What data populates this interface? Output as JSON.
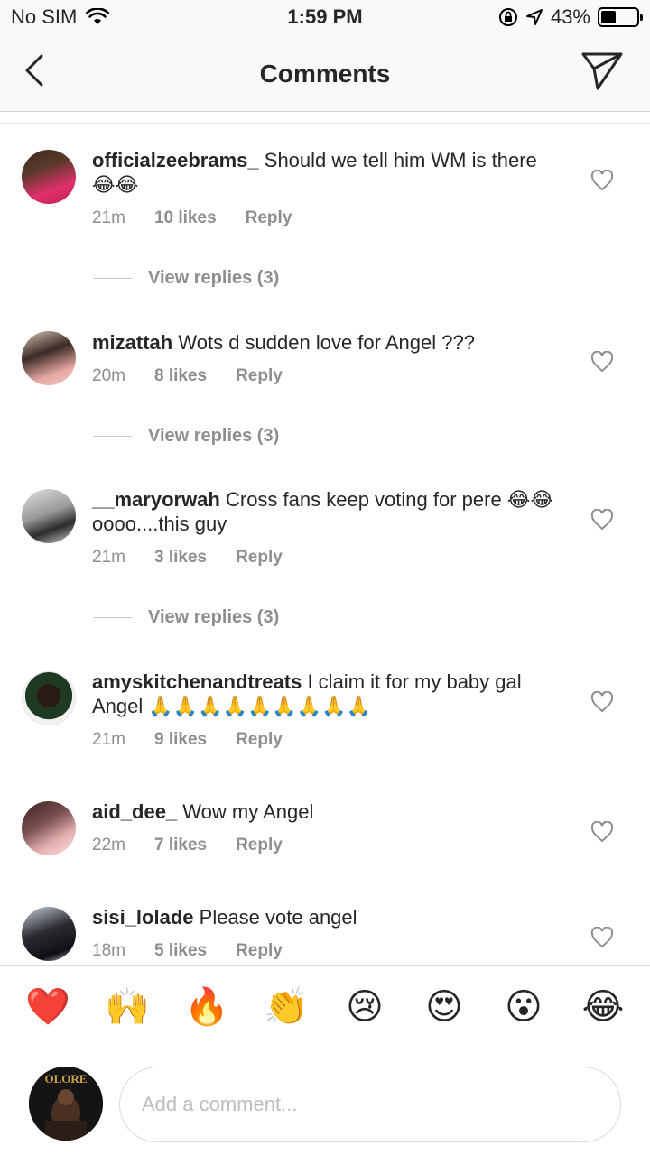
{
  "status": {
    "carrier": "No SIM",
    "time": "1:59 PM",
    "battery": "43%",
    "battery_level": 0.43
  },
  "nav": {
    "title": "Comments",
    "back_icon": "chevron-left-icon",
    "send_icon": "paper-plane-icon"
  },
  "comments": [
    {
      "user": "officialzeebrams_",
      "text": "Should we tell him WM is there 😂😂",
      "time": "21m",
      "likes": "10 likes",
      "reply": "Reply",
      "view_replies": "View replies (3)"
    },
    {
      "user": "mizattah",
      "text": "Wots d sudden love for Angel ???",
      "time": "20m",
      "likes": "8 likes",
      "reply": "Reply",
      "view_replies": "View replies (3)"
    },
    {
      "user": "__maryorwah",
      "text": "Cross fans keep voting for pere 😂😂oooo....this guy",
      "time": "21m",
      "likes": "3 likes",
      "reply": "Reply",
      "view_replies": "View replies (3)"
    },
    {
      "user": "amyskitchenandtreats",
      "text": "I claim it for my baby gal Angel 🙏🙏🙏🙏🙏🙏🙏🙏🙏",
      "time": "21m",
      "likes": "9 likes",
      "reply": "Reply"
    },
    {
      "user": "aid_dee_",
      "text": "Wow my Angel",
      "time": "22m",
      "likes": "7 likes",
      "reply": "Reply"
    },
    {
      "user": "sisi_lolade",
      "text": "Please vote angel",
      "time": "18m",
      "likes": "5 likes",
      "reply": "Reply"
    }
  ],
  "emoji_bar": [
    "❤️",
    "🙌",
    "🔥",
    "👏",
    "😢",
    "😍",
    "😮",
    "😂"
  ],
  "composer": {
    "placeholder": "Add a comment...",
    "avatar_text": "OLORE"
  }
}
